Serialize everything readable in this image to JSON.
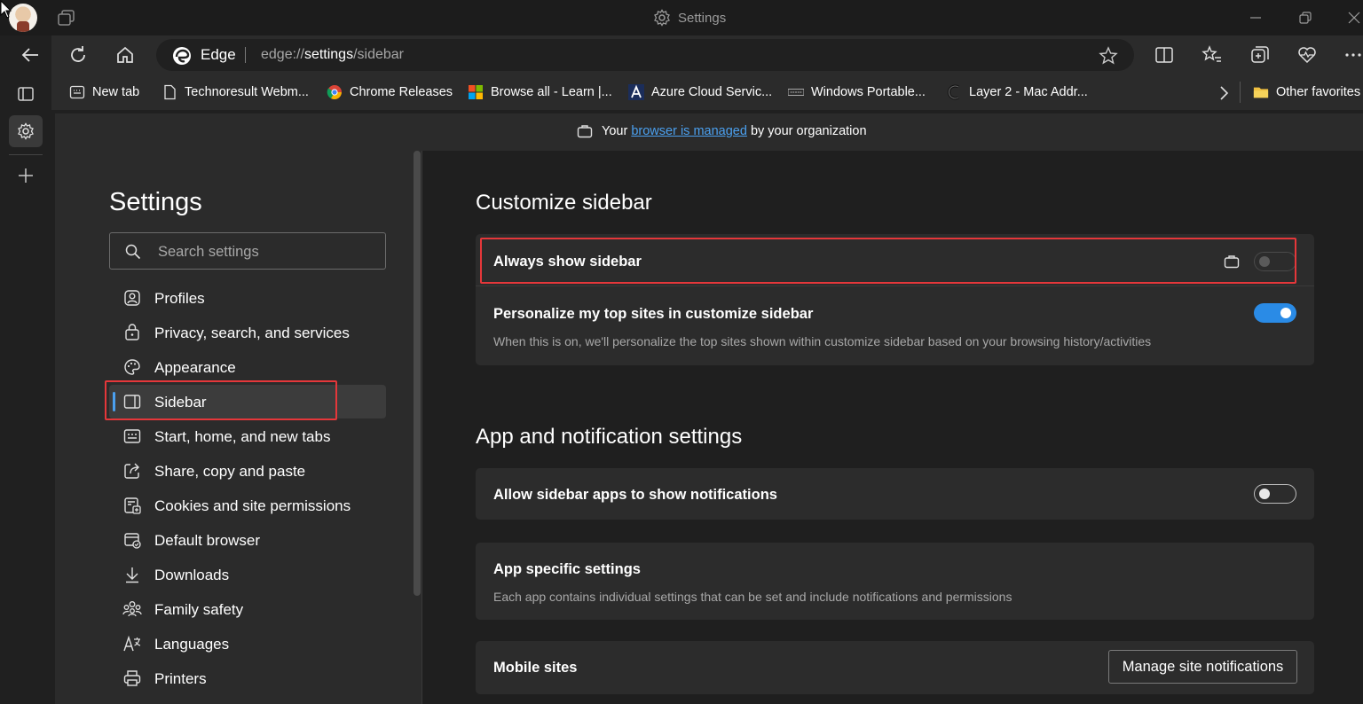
{
  "window": {
    "title": "Settings"
  },
  "address_bar": {
    "browser_label": "Edge",
    "url_prefix": "edge://",
    "url_host": "settings",
    "url_path": "/sidebar"
  },
  "favorites": [
    {
      "label": "New tab",
      "icon": "new-tab-icon"
    },
    {
      "label": "Technoresult Webm...",
      "icon": "page-icon"
    },
    {
      "label": "Chrome Releases",
      "icon": "chrome-icon"
    },
    {
      "label": "Browse all - Learn |...",
      "icon": "microsoft-logo-icon"
    },
    {
      "label": "Azure Cloud Servic...",
      "icon": "azure-icon"
    },
    {
      "label": "Windows Portable...",
      "icon": "site-favicon-icon"
    },
    {
      "label": "Layer 2 - Mac Addr...",
      "icon": "site-favicon-icon"
    }
  ],
  "other_favorites": "Other favorites",
  "banner": {
    "prefix": "Your",
    "link": "browser is managed",
    "suffix": "by your organization"
  },
  "settings_nav": {
    "title": "Settings",
    "search_placeholder": "Search settings",
    "items": [
      {
        "label": "Profiles",
        "icon": "profile-icon"
      },
      {
        "label": "Privacy, search, and services",
        "icon": "lock-icon"
      },
      {
        "label": "Appearance",
        "icon": "palette-icon"
      },
      {
        "label": "Sidebar",
        "icon": "sidebar-icon",
        "selected": true
      },
      {
        "label": "Start, home, and new tabs",
        "icon": "home-tabs-icon"
      },
      {
        "label": "Share, copy and paste",
        "icon": "share-icon"
      },
      {
        "label": "Cookies and site permissions",
        "icon": "cookies-icon"
      },
      {
        "label": "Default browser",
        "icon": "default-browser-icon"
      },
      {
        "label": "Downloads",
        "icon": "download-icon"
      },
      {
        "label": "Family safety",
        "icon": "family-icon"
      },
      {
        "label": "Languages",
        "icon": "languages-icon"
      },
      {
        "label": "Printers",
        "icon": "printer-icon"
      }
    ]
  },
  "customize": {
    "title": "Customize sidebar",
    "always_show": {
      "label": "Always show sidebar",
      "state": "off",
      "managed": true
    },
    "personalize": {
      "label": "Personalize my top sites in customize sidebar",
      "description": "When this is on, we'll personalize the top sites shown within customize sidebar based on your browsing history/activities",
      "state": "on"
    }
  },
  "app_notifications": {
    "title": "App and notification settings",
    "allow_notifications": {
      "label": "Allow sidebar apps to show notifications",
      "state": "off"
    },
    "app_specific": {
      "label": "App specific settings",
      "description": "Each app contains individual settings that can be set and include notifications and permissions"
    },
    "mobile_sites": {
      "label": "Mobile sites",
      "button": "Manage site notifications"
    }
  },
  "colors": {
    "accent": "#2a8be6",
    "link": "#4ba0ef",
    "highlight_box": "#e5373a"
  }
}
